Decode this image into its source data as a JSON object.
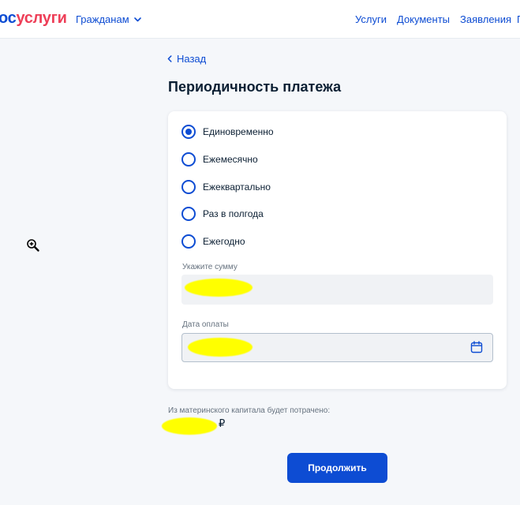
{
  "header": {
    "logo_part_blue": "ос",
    "logo_part_red": "услуги",
    "citizens_label": "Гражданам",
    "nav": [
      {
        "label": "Услуги"
      },
      {
        "label": "Документы"
      },
      {
        "label": "Заявления"
      },
      {
        "label": "П"
      }
    ]
  },
  "back_label": "Назад",
  "page_title": "Периодичность платежа",
  "payment_frequency": {
    "options": [
      {
        "label": "Единовременно",
        "selected": true
      },
      {
        "label": "Ежемесячно",
        "selected": false
      },
      {
        "label": "Ежеквартально",
        "selected": false
      },
      {
        "label": "Раз в полгода",
        "selected": false
      },
      {
        "label": "Ежегодно",
        "selected": false
      }
    ]
  },
  "amount_field": {
    "label": "Укажите сумму",
    "value": ""
  },
  "date_field": {
    "label": "Дата оплаты",
    "value": ""
  },
  "spend": {
    "label": "Из материнского капитала будет потрачено:",
    "currency": "₽"
  },
  "continue_label": "Продолжить",
  "colors": {
    "primary": "#0d4cd3",
    "logo_red": "#ee3f58",
    "redaction": "#ffff00",
    "background": "#f5f7fa"
  },
  "icons": [
    "chevron-down-icon",
    "chevron-left-icon",
    "calendar-icon",
    "zoom-in-cursor-icon"
  ]
}
